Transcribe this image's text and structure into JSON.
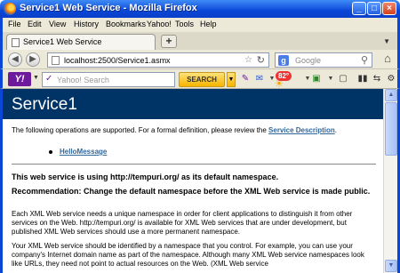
{
  "window": {
    "title": "Service1 Web Service - Mozilla Firefox"
  },
  "menu": [
    "File",
    "Edit",
    "View",
    "History",
    "Bookmarks",
    "Yahoo!",
    "Tools",
    "Help"
  ],
  "tab": {
    "label": "Service1 Web Service",
    "new_tab": "+"
  },
  "nav": {
    "url": "localhost:2500/Service1.asmx",
    "search_placeholder": "Google"
  },
  "yahoo": {
    "search_placeholder": "Yahoo! Search",
    "search_button": "SEARCH",
    "weather": "82°"
  },
  "page": {
    "title": "Service1",
    "intro": "The following operations are supported. For a formal definition, please review the ",
    "intro_link": "Service Description",
    "intro_end": ".",
    "operation": "HelloMessage",
    "namespace_heading": "This web service is using http://tempuri.org/ as its default namespace.",
    "recommendation": "Recommendation: Change the default namespace before the XML Web service is made public.",
    "para1": "Each XML Web service needs a unique namespace in order for client applications to distinguish it from other services on the Web. http://tempuri.org/ is available for XML Web services that are under development, but published XML Web services should use a more permanent namespace.",
    "para2": "Your XML Web service should be identified by a namespace that you control. For example, you can use your company's Internet domain name as part of the namespace. Although many XML Web service namespaces look like URLs, they need not point to actual resources on the Web. (XML Web service"
  }
}
